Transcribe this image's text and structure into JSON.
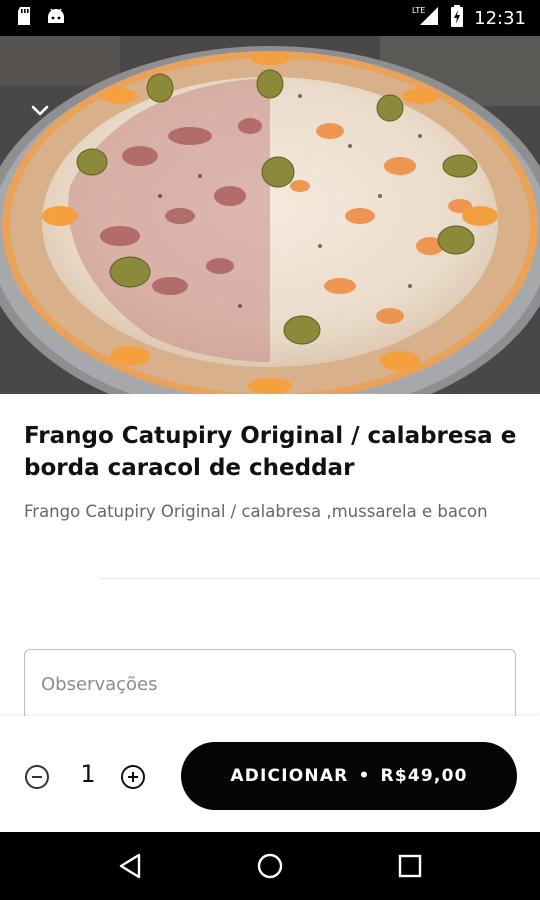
{
  "status_bar": {
    "time": "12:31",
    "network_label": "LTE",
    "icons": [
      "sd-card-icon",
      "android-icon",
      "signal-icon",
      "battery-charging-icon"
    ]
  },
  "product": {
    "title": "Frango Catupiry Original / calabresa e borda caracol de cheddar",
    "description": "Frango Catupiry Original / calabresa ,mussarela e bacon",
    "image_subject": "pizza"
  },
  "notes": {
    "placeholder": "Observações",
    "value": ""
  },
  "order": {
    "quantity": "1",
    "add_label": "ADICIONAR",
    "separator": "•",
    "price": "R$49,00"
  },
  "nav": {
    "icons": [
      "back-icon",
      "home-icon",
      "recents-icon"
    ]
  },
  "colors": {
    "button_bg": "#050505",
    "button_text": "#ffffff",
    "status_bar": "#000000"
  }
}
